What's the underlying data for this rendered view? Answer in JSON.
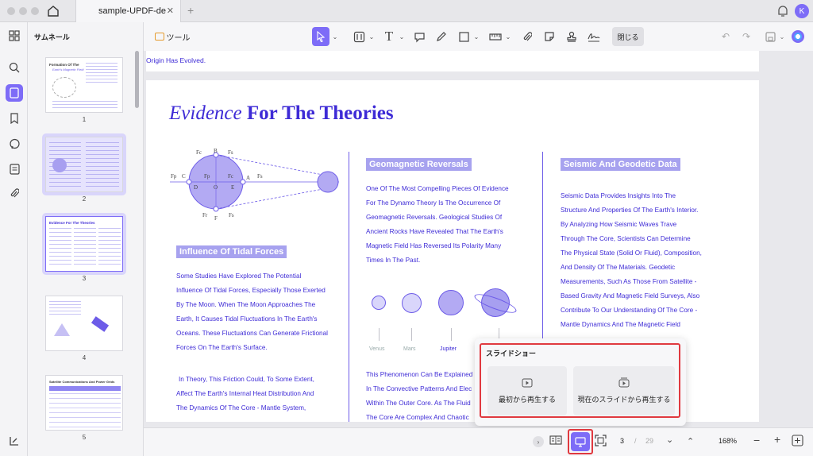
{
  "titlebar": {
    "tab_title": "sample-UPDF-de",
    "avatar_letter": "K"
  },
  "sidebar": {
    "title": "サムネール",
    "thumbnails": [
      {
        "num": "1",
        "heading": "Formation Of The",
        "sub": "Earth's Magnetic Field"
      },
      {
        "num": "2"
      },
      {
        "num": "3",
        "heading": "Evidence For The Theories"
      },
      {
        "num": "4"
      },
      {
        "num": "5",
        "heading": "Satellite Communications And Power Grids"
      }
    ]
  },
  "toolbar": {
    "tools_label": "ツール",
    "close_label": "閉じる"
  },
  "document": {
    "top_strip": "Origin Has Evolved.",
    "title_italic": "Evidence",
    "title_bold": "For The Theories",
    "diagram_labels": {
      "fc": "Fc",
      "b": "B",
      "fs_top": "Fs",
      "fp": "Fp",
      "c": "C",
      "fp2": "Fp",
      "fc2": "Fc",
      "d": "D",
      "o": "O",
      "a": "A",
      "e": "E",
      "fs_mid": "Fs",
      "fr": "Fr",
      "f": "F",
      "fs_bot": "Fs"
    },
    "col1": {
      "heading": "Influence Of Tidal Forces",
      "p1": [
        "Some Studies Have Explored The Potential",
        "Influence Of Tidal Forces, Especially Those Exerted",
        "By The Moon. When The Moon Approaches The",
        "Earth, It Causes Tidal Fluctuations In The Earth's",
        "Oceans. These Fluctuations Can Generate Frictional",
        "Forces On The Earth's Surface."
      ],
      "p2": [
        "In Theory, This Friction Could, To Some Extent,",
        "Affect The Earth's Internal Heat Distribution And",
        "The Dynamics Of The Core - Mantle System,"
      ]
    },
    "col2": {
      "heading": "Geomagnetic Reversals",
      "p1": [
        "One Of The Most Compelling Pieces Of Evidence",
        "For The Dynamo Theory Is The Occurrence Of",
        "Geomagnetic Reversals. Geological Studies Of",
        "Ancient Rocks Have Revealed That The Earth's",
        "Magnetic Field Has Reversed Its Polarity Many",
        "Times In The Past."
      ],
      "planets": [
        "Venus",
        "Mars",
        "Jupiter"
      ],
      "p2": [
        "This Phenomenon Can Be Explained",
        "In The Convective Patterns And Elec",
        "Within The Outer Core. As The Fluid",
        "The Core Are Complex And Chaotic"
      ]
    },
    "col3": {
      "heading": "Seismic And Geodetic Data",
      "p1": [
        "Seismic Data Provides Insights Into The",
        "Structure And Properties Of The Earth's Interior.",
        "By Analyzing How Seismic Waves Trave",
        "Through The Core, Scientists Can Determine",
        "The Physical State (Solid Or Fluid), Composition,",
        "And Density Of The Materials. Geodetic",
        "Measurements, Such As Those From Satellite -",
        "Based Gravity And Magnetic Field Surveys, Also",
        "Contribute To Our Understanding Of The Core -",
        "Mantle Dynamics And The Magnetic Field"
      ]
    }
  },
  "popup": {
    "title": "スライドショー",
    "from_start": "最初から再生する",
    "from_current": "現在のスライドから再生する"
  },
  "bottombar": {
    "current_page": "3",
    "separator": "/",
    "total_pages": "29",
    "zoom": "168%"
  },
  "colors": {
    "accent": "#7d6cf7",
    "doc_text": "#3e2bd6",
    "highlight_red": "#e0393f"
  }
}
